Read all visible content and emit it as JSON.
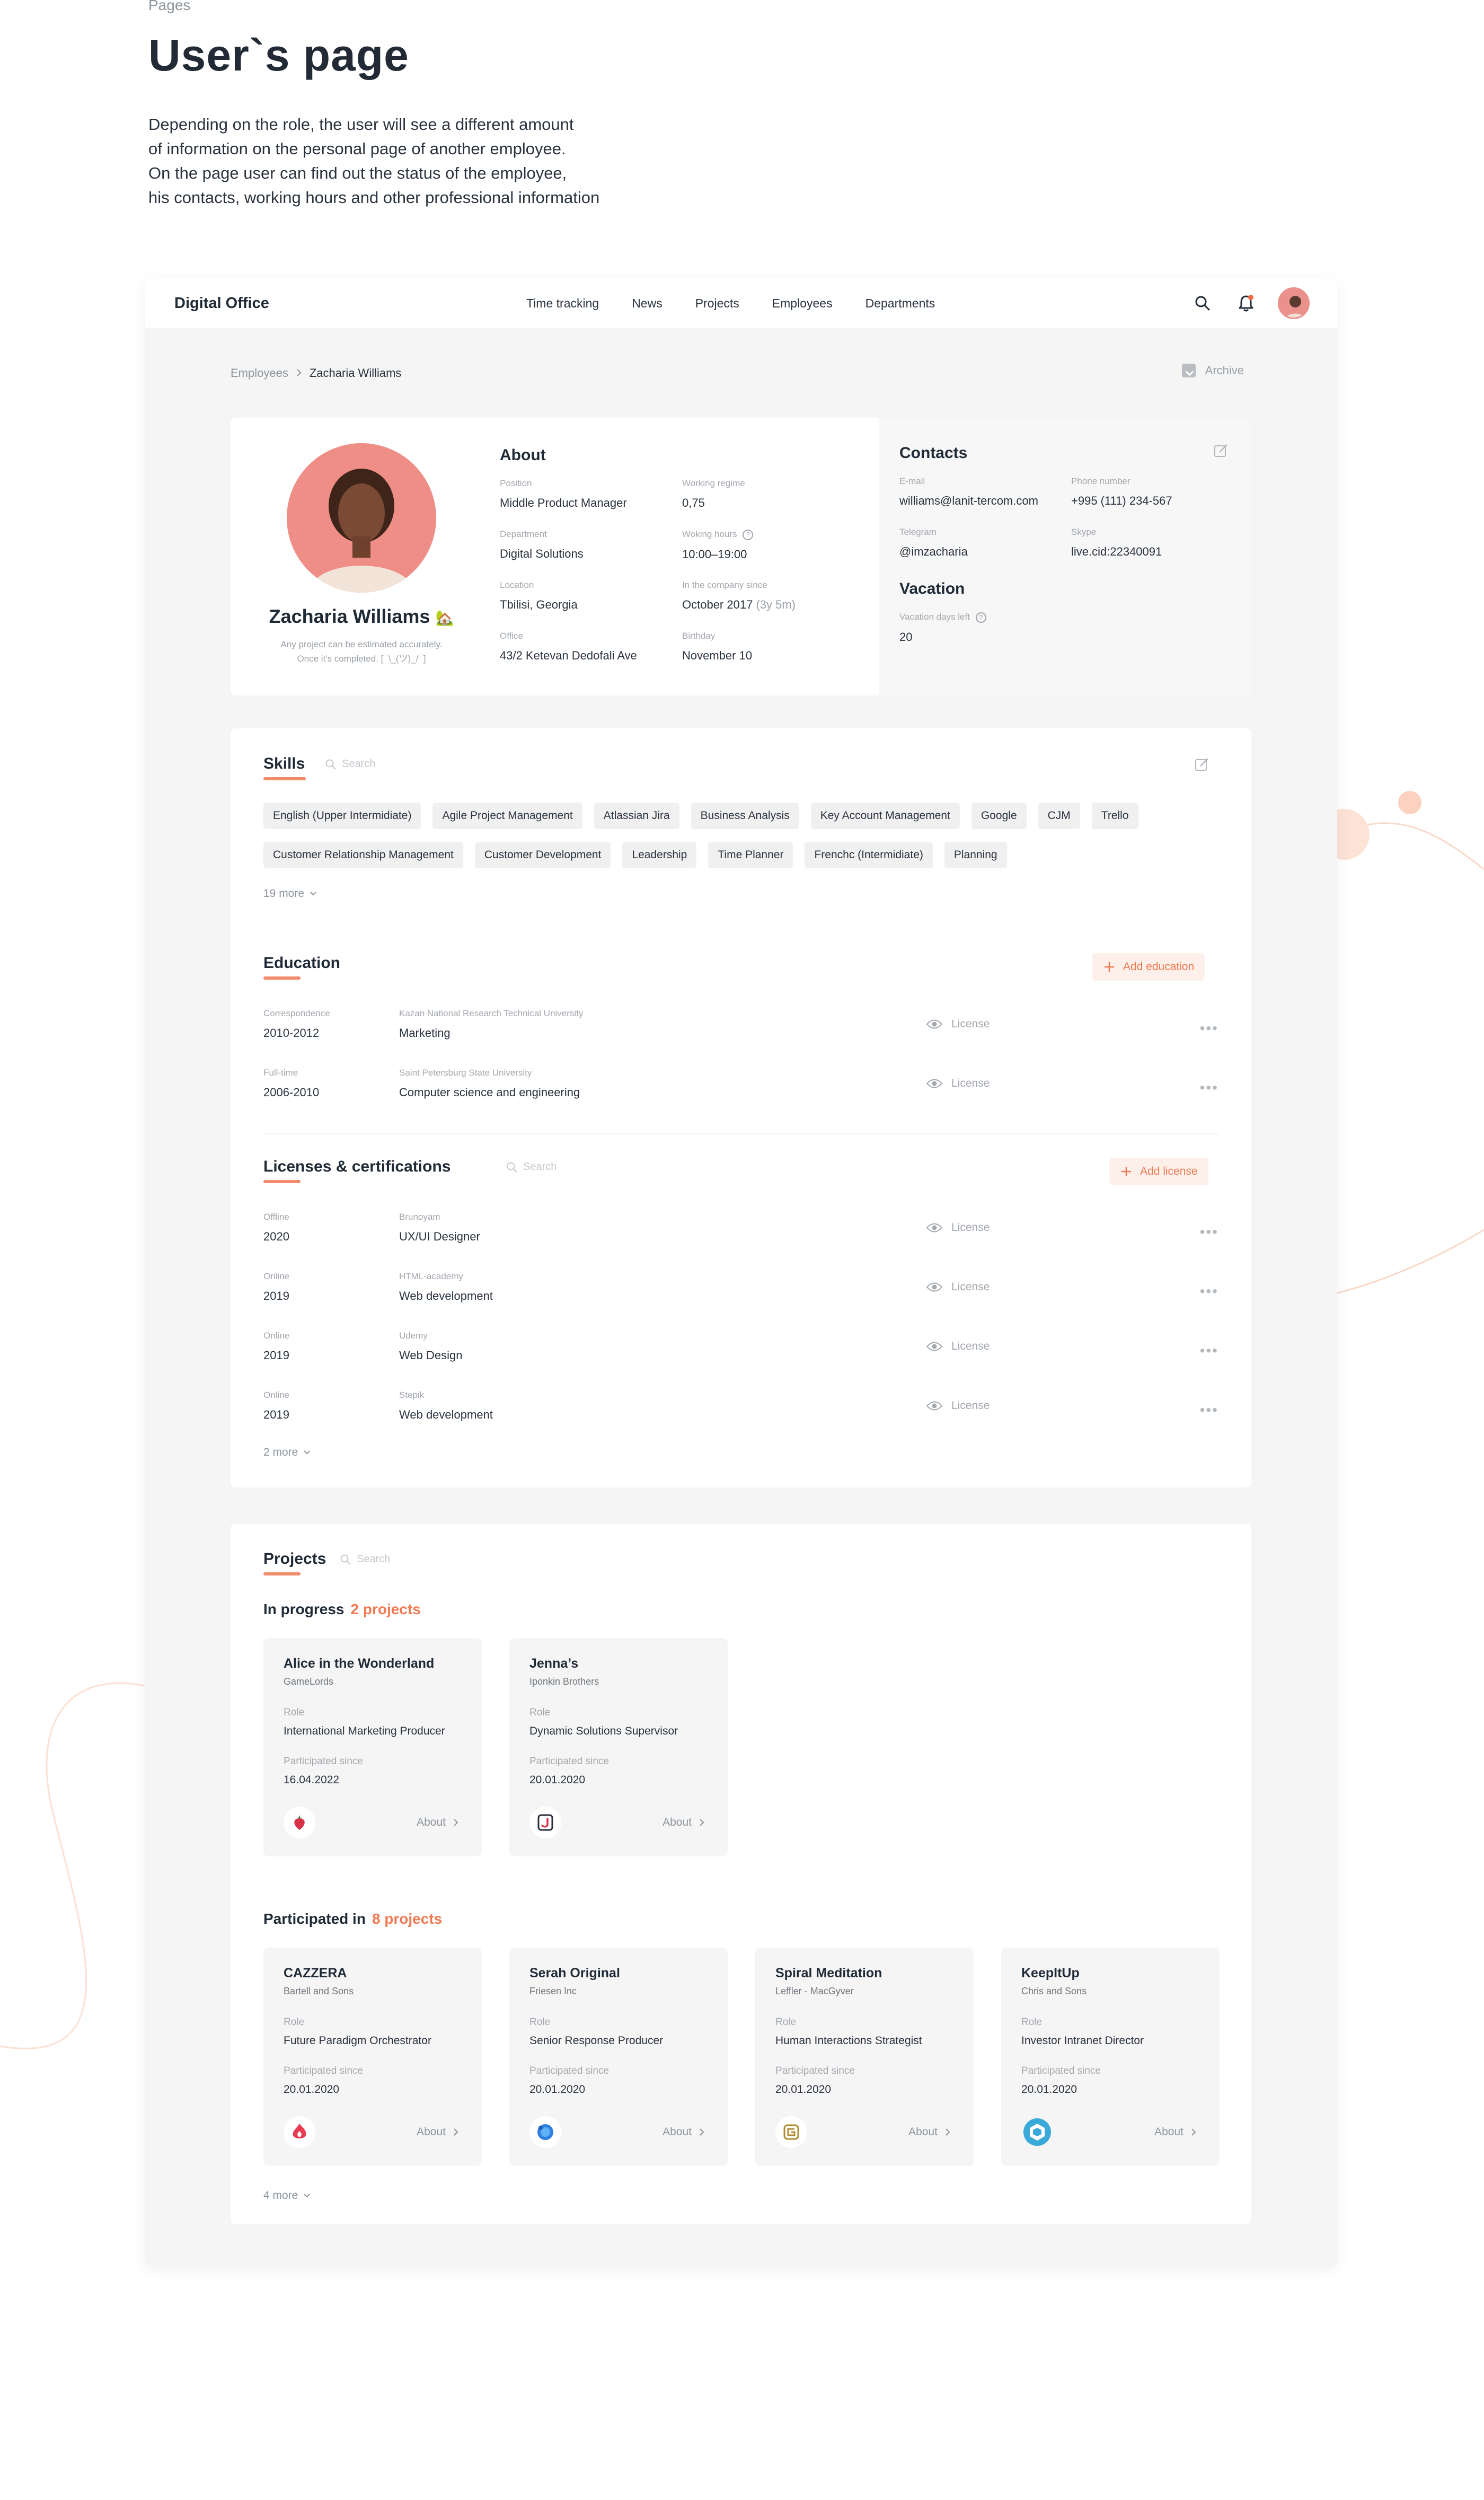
{
  "intro": {
    "kicker": "Pages",
    "title": "User`s page",
    "desc": [
      "Depending on the role, the user will see a different amount",
      "of information on the personal page of another employee.",
      "On the page user can find out the status of the employee,",
      "his contacts, working hours and other professional information"
    ]
  },
  "app": {
    "logo": "Digital Office",
    "nav": [
      "Time tracking",
      "News",
      "Projects",
      "Employees",
      "Departments"
    ],
    "icons": {
      "search": "search-icon",
      "bell": "bell-icon"
    }
  },
  "breadcrumb": {
    "parent": "Employees",
    "current": "Zacharia Williams"
  },
  "archive_label": "Archive",
  "profile": {
    "name": "Zacharia Williams",
    "emoji": "🏡",
    "note_line1": "Any project can be estimated accurately.",
    "note_line2": "Once it's completed. [¯\\_(ツ)_/¯]",
    "about_title": "About",
    "fields": {
      "position": {
        "label": "Position",
        "value": "Middle Product Manager"
      },
      "regime": {
        "label": "Working regime",
        "value": "0,75"
      },
      "department": {
        "label": "Department",
        "value": "Digital Solutions"
      },
      "hours": {
        "label": "Woking hours",
        "value": "10:00–19:00"
      },
      "location": {
        "label": "Location",
        "value": "Tbilisi, Georgia"
      },
      "since": {
        "label": "In the company since",
        "value": "October 2017",
        "extra": "(3y 5m)"
      },
      "office": {
        "label": "Office",
        "value": "43/2 Ketevan Dedofali Ave"
      },
      "birthday": {
        "label": "Birthday",
        "value": "November 10"
      }
    }
  },
  "contacts": {
    "title": "Contacts",
    "email": {
      "label": "E-mail",
      "value": "williams@lanit-tercom.com"
    },
    "phone": {
      "label": "Phone number",
      "value": "+995 (111) 234-567"
    },
    "telegram": {
      "label": "Telegram",
      "value": "@imzacharia"
    },
    "skype": {
      "label": "Skype",
      "value": "live.cid:22340091"
    },
    "vacation_title": "Vacation",
    "vacation": {
      "label": "Vacation days left",
      "value": "20"
    }
  },
  "skills": {
    "title": "Skills",
    "search_placeholder": "Search",
    "row1": [
      "English (Upper Intermidiate)",
      "Agile Project Management",
      "Atlassian Jira",
      "Business Analysis",
      "Key Account Management",
      "Google",
      "CJM",
      "Trello"
    ],
    "row2": [
      "Customer Relationship Management",
      "Customer Development",
      "Leadership",
      "Time Planner",
      "Frenchc (Intermidiate)",
      "Planning"
    ],
    "more": "19 more"
  },
  "education": {
    "title": "Education",
    "add_label": "Add education",
    "items": [
      {
        "type": "Correspondence",
        "years": "2010-2012",
        "org": "Kazan National Research Technical University",
        "field": "Marketing",
        "license": "License"
      },
      {
        "type": "Full-time",
        "years": "2006-2010",
        "org": "Saint Petersburg State University",
        "field": "Computer science and engineering",
        "license": "License"
      }
    ]
  },
  "licenses": {
    "title": "Licenses & certifications",
    "search_placeholder": "Search",
    "add_label": "Add license",
    "items": [
      {
        "type": "Offline",
        "year": "2020",
        "org": "Brunoyam",
        "name": "UX/UI Designer",
        "license": "License"
      },
      {
        "type": "Online",
        "year": "2019",
        "org": "HTML-academy",
        "name": "Web development",
        "license": "License"
      },
      {
        "type": "Online",
        "year": "2019",
        "org": "Udemy",
        "name": "Web Design",
        "license": "License"
      },
      {
        "type": "Online",
        "year": "2019",
        "org": "Stepik",
        "name": "Web development",
        "license": "License"
      }
    ],
    "more": "2 more"
  },
  "projects": {
    "title": "Projects",
    "search_placeholder": "Search",
    "in_progress_label": "In progress",
    "in_progress_count": "2 projects",
    "participated_label": "Participated in",
    "participated_count": "8 projects",
    "role_label": "Role",
    "since_label": "Participated since",
    "about_label": "About",
    "in_progress": [
      {
        "title": "Alice in the Wonderland",
        "company": "GameLords",
        "role": "International Marketing Producer",
        "since": "16.04.2022",
        "logo": "strawberry-logo-icon"
      },
      {
        "title": "Jenna’s",
        "company": "Iponkin Brothers",
        "role": "Dynamic Solutions Supervisor",
        "since": "20.01.2020",
        "logo": "letter-j-logo-icon"
      }
    ],
    "participated": [
      {
        "title": "CAZZERA",
        "company": "Bartell and Sons",
        "role": "Future Paradigm Orchestrator",
        "since": "20.01.2020",
        "logo": "flame-logo-icon"
      },
      {
        "title": "Serah Original",
        "company": "Friesen Inc",
        "role": "Senior Response Producer",
        "since": "20.01.2020",
        "logo": "globe-logo-icon"
      },
      {
        "title": "Spiral Meditation",
        "company": "Leffler - MacGyver",
        "role": "Human Interactions Strategist",
        "since": "20.01.2020",
        "logo": "spiral-logo-icon"
      },
      {
        "title": "KeepItUp",
        "company": "Chris and Sons",
        "role": "Investor Intranet Director",
        "since": "20.01.2020",
        "logo": "cube-logo-icon"
      }
    ],
    "more": "4 more"
  },
  "colors": {
    "accent": "#f07a52",
    "avatar": "#ee8e87",
    "background": "#f5f5f5"
  }
}
